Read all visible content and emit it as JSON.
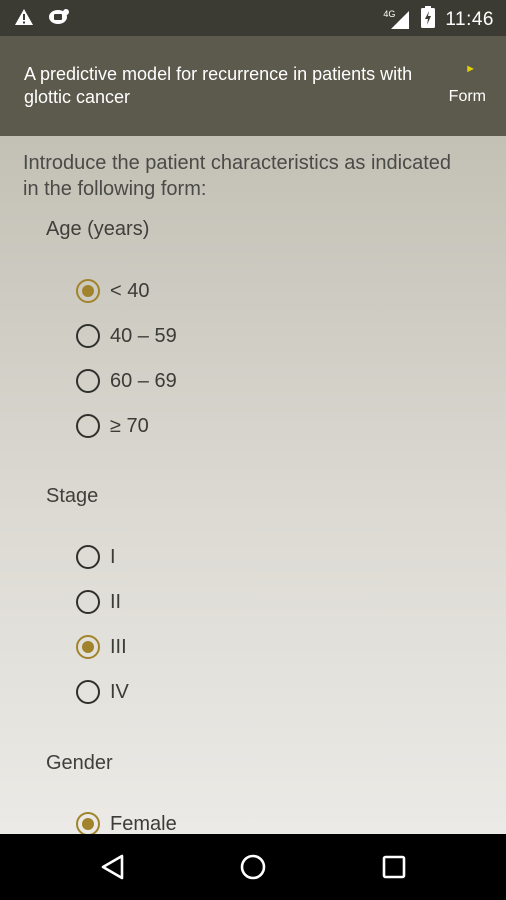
{
  "status_bar": {
    "time": "11:46",
    "network": "4G",
    "icons": [
      "warning-icon",
      "notification-icon",
      "signal-icon",
      "battery-icon"
    ]
  },
  "app_bar": {
    "title": "A predictive model for recurrence in patients with glottic cancer",
    "action_label": "Form",
    "action_icon": "play-arrow-icon",
    "action_icon_color": "#e4d100"
  },
  "main": {
    "intro": "Introduce the patient characteristics as indicated in the following form:",
    "groups": [
      {
        "label": "Age (years)",
        "options": [
          {
            "label": "< 40",
            "selected": true
          },
          {
            "label": "40 – 59",
            "selected": false
          },
          {
            "label": "60 – 69",
            "selected": false
          },
          {
            "label": "≥ 70",
            "selected": false
          }
        ]
      },
      {
        "label": "Stage",
        "options": [
          {
            "label": "I",
            "selected": false
          },
          {
            "label": "II",
            "selected": false
          },
          {
            "label": "III",
            "selected": true
          },
          {
            "label": "IV",
            "selected": false
          }
        ]
      },
      {
        "label": "Gender",
        "options": [
          {
            "label": "Female",
            "selected": true
          }
        ]
      }
    ]
  },
  "nav_bar": {
    "icons": [
      "back-icon",
      "home-icon",
      "recents-icon"
    ]
  },
  "colors": {
    "status_bar": "#3c3b33",
    "app_bar": "#5b5a4c",
    "accent": "#a0832a"
  }
}
